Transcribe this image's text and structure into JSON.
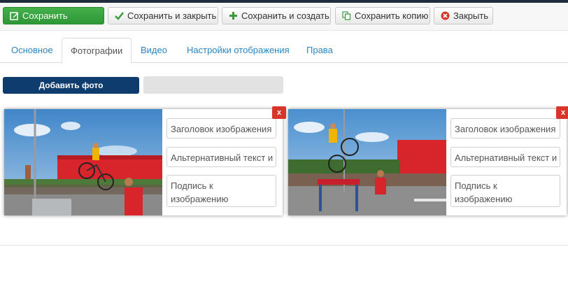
{
  "toolbar": {
    "save": "Сохранить",
    "save_close": "Сохранить и закрыть",
    "save_new": "Сохранить и создать",
    "save_copy": "Сохранить копию",
    "close": "Закрыть",
    "icons": {
      "save": "edit-icon",
      "save_close": "check-icon",
      "save_new": "plus-icon",
      "save_copy": "copy-icon",
      "close": "close-circle-icon"
    },
    "colors": {
      "save_bg": "#2e9636",
      "close_icon": "#d9362b",
      "check_icon": "#3a9a3a",
      "plus_icon": "#3a9a3a"
    }
  },
  "tabs": [
    {
      "label": "Основное",
      "active": false
    },
    {
      "label": "Фотографии",
      "active": true
    },
    {
      "label": "Видео",
      "active": false
    },
    {
      "label": "Настройки отображения",
      "active": false
    },
    {
      "label": "Права",
      "active": false
    }
  ],
  "upload": {
    "add_label": "Добавить фото",
    "progress": 0,
    "colors": {
      "button": "#0f3c6e",
      "track": "#e2e2e2"
    }
  },
  "photos": [
    {
      "title_placeholder": "Заголовок изображения",
      "alt_placeholder": "Альтернативный текст и",
      "caption_placeholder": "Подпись к изображению",
      "delete_label": "x"
    },
    {
      "title_placeholder": "Заголовок изображения",
      "alt_placeholder": "Альтернативный текст и",
      "caption_placeholder": "Подпись к изображению",
      "delete_label": "x"
    }
  ]
}
